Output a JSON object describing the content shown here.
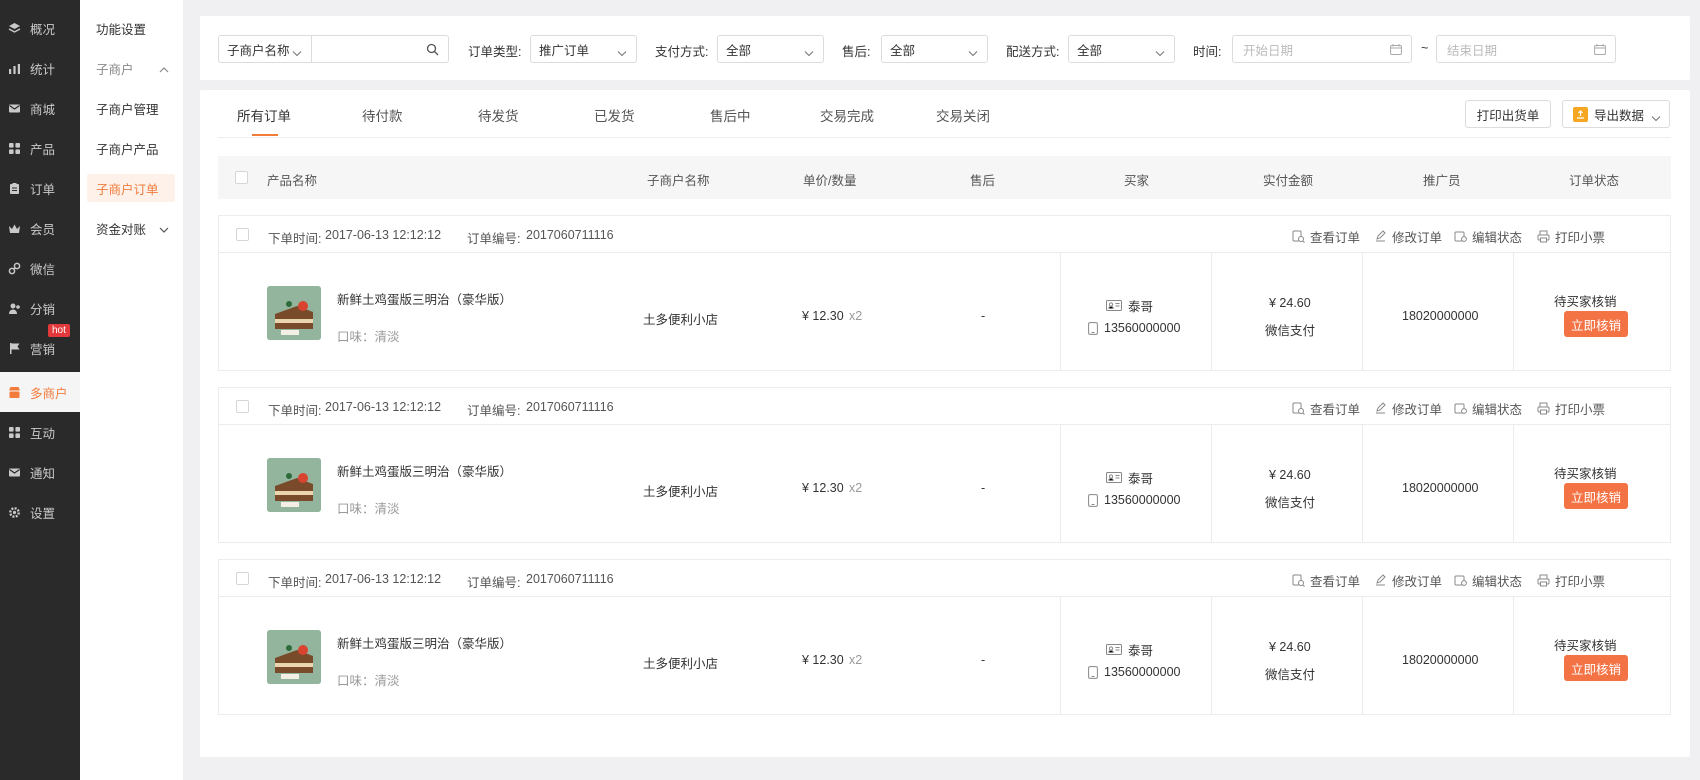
{
  "main_nav": {
    "items": [
      {
        "label": "概况",
        "icon": "layers-icon"
      },
      {
        "label": "统计",
        "icon": "chart-icon"
      },
      {
        "label": "商城",
        "icon": "mail-icon"
      },
      {
        "label": "产品",
        "icon": "grid-icon"
      },
      {
        "label": "订单",
        "icon": "clipboard-icon"
      },
      {
        "label": "会员",
        "icon": "crown-icon"
      },
      {
        "label": "微信",
        "icon": "link-icon"
      },
      {
        "label": "分销",
        "icon": "users-icon"
      },
      {
        "label": "营销",
        "icon": "flag-icon"
      },
      {
        "label": "多商户",
        "icon": "store-icon"
      },
      {
        "label": "互动",
        "icon": "grid-icon"
      },
      {
        "label": "通知",
        "icon": "mail-icon"
      },
      {
        "label": "设置",
        "icon": "gear-icon"
      }
    ],
    "hot_badge": "hot",
    "accent_color": "#f27c3c"
  },
  "sub_nav": {
    "items": [
      {
        "label": "功能设置"
      },
      {
        "label": "子商户"
      },
      {
        "label": "子商户管理"
      },
      {
        "label": "子商户产品"
      },
      {
        "label": "子商户订单"
      },
      {
        "label": "资金对账"
      }
    ]
  },
  "filters": {
    "merchant_select": "子商户名称",
    "order_type_label": "订单类型:",
    "order_type_value": "推广订单",
    "pay_label": "支付方式:",
    "pay_value": "全部",
    "after_sale_label": "售后:",
    "after_sale_value": "全部",
    "delivery_label": "配送方式:",
    "delivery_value": "全部",
    "time_label": "时间:",
    "start_placeholder": "开始日期",
    "separator": "~",
    "end_placeholder": "结束日期"
  },
  "tabs": [
    {
      "label": "所有订单"
    },
    {
      "label": "待付款"
    },
    {
      "label": "待发货"
    },
    {
      "label": "已发货"
    },
    {
      "label": "售后中"
    },
    {
      "label": "交易完成"
    },
    {
      "label": "交易关闭"
    }
  ],
  "toolbar": {
    "print_label": "打印出货单",
    "export_label": "导出数据"
  },
  "columns": [
    "产品名称",
    "子商户名称",
    "单价/数量",
    "售后",
    "买家",
    "实付金额",
    "推广员",
    "订单状态"
  ],
  "order_actions": [
    "查看订单",
    "修改订单",
    "编辑状态",
    "打印小票"
  ],
  "orders": [
    {
      "time_label": "下单时间:",
      "time": "2017-06-13 12:12:12",
      "no_label": "订单编号:",
      "no": "2017060711116",
      "product": "新鲜土鸡蛋版三明治（豪华版）",
      "flavor": "口味：清淡",
      "merchant": "土多便利小店",
      "price": "¥ 12.30",
      "qty": "x2",
      "after_sale": "-",
      "buyer_name": "泰哥",
      "buyer_phone": "13560000000",
      "amount": "¥ 24.60",
      "pay": "微信支付",
      "promoter": "18020000000",
      "status": "待买家核销",
      "action": "立即核销"
    },
    {
      "time_label": "下单时间:",
      "time": "2017-06-13 12:12:12",
      "no_label": "订单编号:",
      "no": "2017060711116",
      "product": "新鲜土鸡蛋版三明治（豪华版）",
      "flavor": "口味：清淡",
      "merchant": "土多便利小店",
      "price": "¥ 12.30",
      "qty": "x2",
      "after_sale": "-",
      "buyer_name": "泰哥",
      "buyer_phone": "13560000000",
      "amount": "¥ 24.60",
      "pay": "微信支付",
      "promoter": "18020000000",
      "status": "待买家核销",
      "action": "立即核销"
    },
    {
      "time_label": "下单时间:",
      "time": "2017-06-13 12:12:12",
      "no_label": "订单编号:",
      "no": "2017060711116",
      "product": "新鲜土鸡蛋版三明治（豪华版）",
      "flavor": "口味：清淡",
      "merchant": "土多便利小店",
      "price": "¥ 12.30",
      "qty": "x2",
      "after_sale": "-",
      "buyer_name": "泰哥",
      "buyer_phone": "13560000000",
      "amount": "¥ 24.60",
      "pay": "微信支付",
      "promoter": "18020000000",
      "status": "待买家核销",
      "action": "立即核销"
    }
  ]
}
